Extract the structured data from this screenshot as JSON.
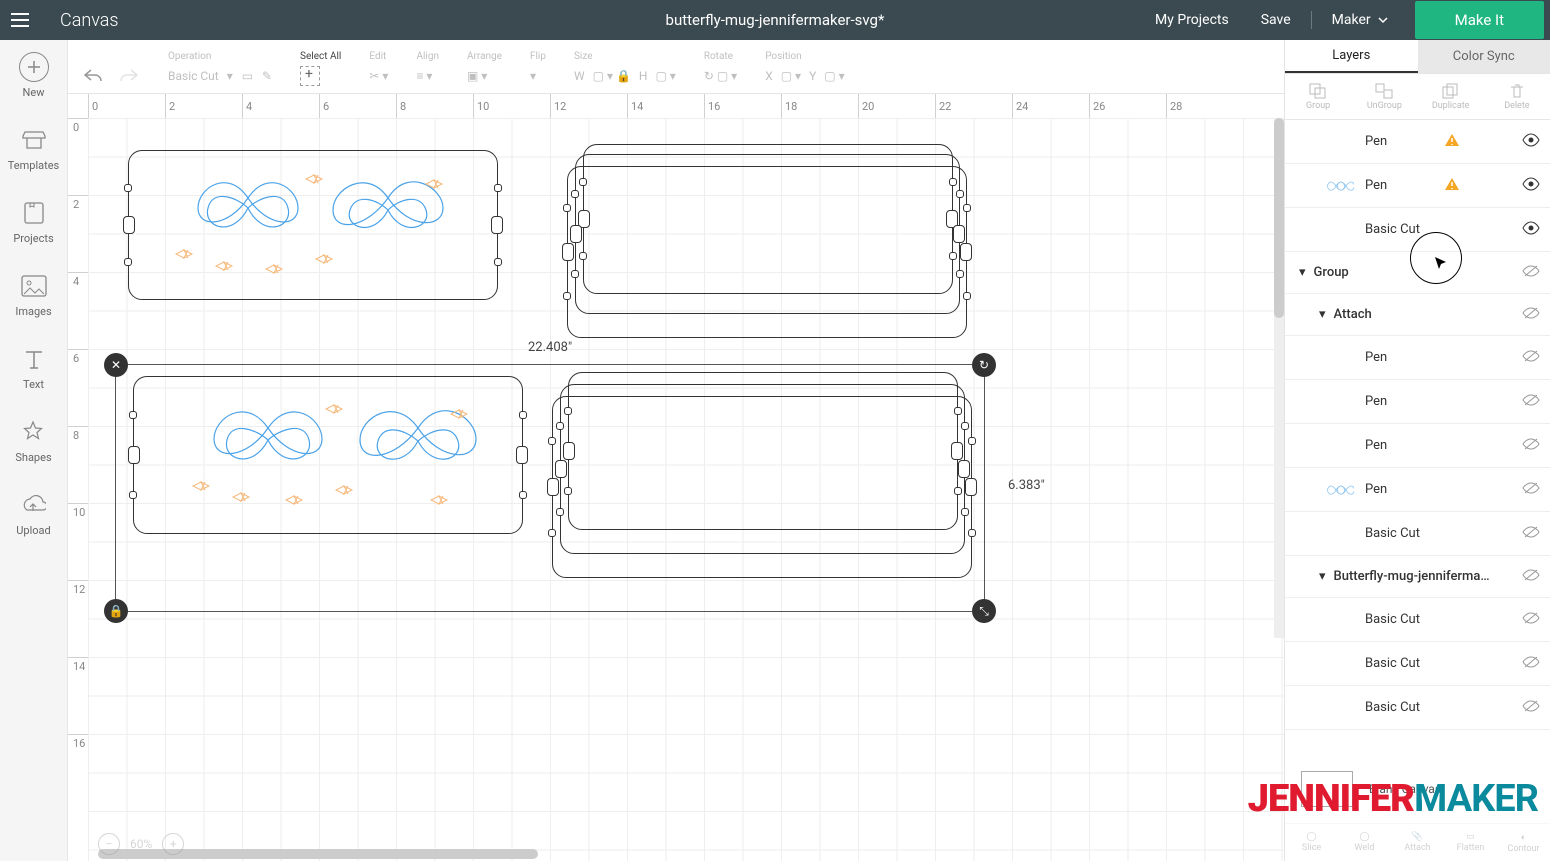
{
  "topbar": {
    "app_title": "Canvas",
    "doc_title": "butterfly-mug-jennifermaker-svg*",
    "my_projects": "My Projects",
    "save": "Save",
    "machine": "Maker",
    "make_it": "Make It"
  },
  "leftbar": {
    "new": "New",
    "templates": "Templates",
    "projects": "Projects",
    "images": "Images",
    "text": "Text",
    "shapes": "Shapes",
    "upload": "Upload"
  },
  "editbar": {
    "operation": "Operation",
    "basic_cut": "Basic Cut",
    "select_all": "Select All",
    "edit": "Edit",
    "align": "Align",
    "arrange": "Arrange",
    "flip": "Flip",
    "size": "Size",
    "w": "W",
    "h": "H",
    "rotate": "Rotate",
    "position": "Position",
    "x": "X",
    "y": "Y"
  },
  "ruler_h": [
    "0",
    "2",
    "4",
    "6",
    "8",
    "10",
    "12",
    "14",
    "16",
    "18",
    "20",
    "22",
    "24",
    "26",
    "28"
  ],
  "ruler_v": [
    "0",
    "2",
    "4",
    "6",
    "8",
    "10",
    "12",
    "14",
    "16"
  ],
  "dims": {
    "width": "22.408\"",
    "height": "6.383\""
  },
  "footer": {
    "zoom": "60%"
  },
  "right": {
    "tabs": {
      "layers": "Layers",
      "colorsync": "Color Sync"
    },
    "actions": {
      "group": "Group",
      "ungroup": "UnGroup",
      "duplicate": "Duplicate",
      "delete": "Delete"
    },
    "layers": [
      {
        "label": "Pen",
        "indent": 2,
        "warn": true,
        "eye": "on"
      },
      {
        "label": "Pen",
        "indent": 2,
        "thm": "bf",
        "warn": true,
        "eye": "on"
      },
      {
        "label": "Basic Cut",
        "indent": 2,
        "eye": "on"
      },
      {
        "label": "Group",
        "indent": 0,
        "header": true,
        "eye": "off"
      },
      {
        "label": "Attach",
        "indent": 1,
        "header": true,
        "eye": "off"
      },
      {
        "label": "Pen",
        "indent": 2,
        "eye": "off"
      },
      {
        "label": "Pen",
        "indent": 2,
        "eye": "off"
      },
      {
        "label": "Pen",
        "indent": 2,
        "eye": "off"
      },
      {
        "label": "Pen",
        "indent": 2,
        "thm": "bf",
        "eye": "off"
      },
      {
        "label": "Basic Cut",
        "indent": 2,
        "eye": "off"
      },
      {
        "label": "Butterfly-mug-jenniferma…",
        "indent": 1,
        "header": true,
        "eye": "off"
      },
      {
        "label": "Basic Cut",
        "indent": 2,
        "eye": "off"
      },
      {
        "label": "Basic Cut",
        "indent": 2,
        "eye": "off"
      },
      {
        "label": "Basic Cut",
        "indent": 2,
        "eye": "off"
      }
    ],
    "blank_canvas": "Blank Canvas",
    "footer_actions": {
      "slice": "Slice",
      "weld": "Weld",
      "attach": "Attach",
      "flatten": "Flatten",
      "contour": "Contour"
    }
  },
  "watermark": {
    "a": "JENNIFER",
    "b": "MAKER"
  }
}
